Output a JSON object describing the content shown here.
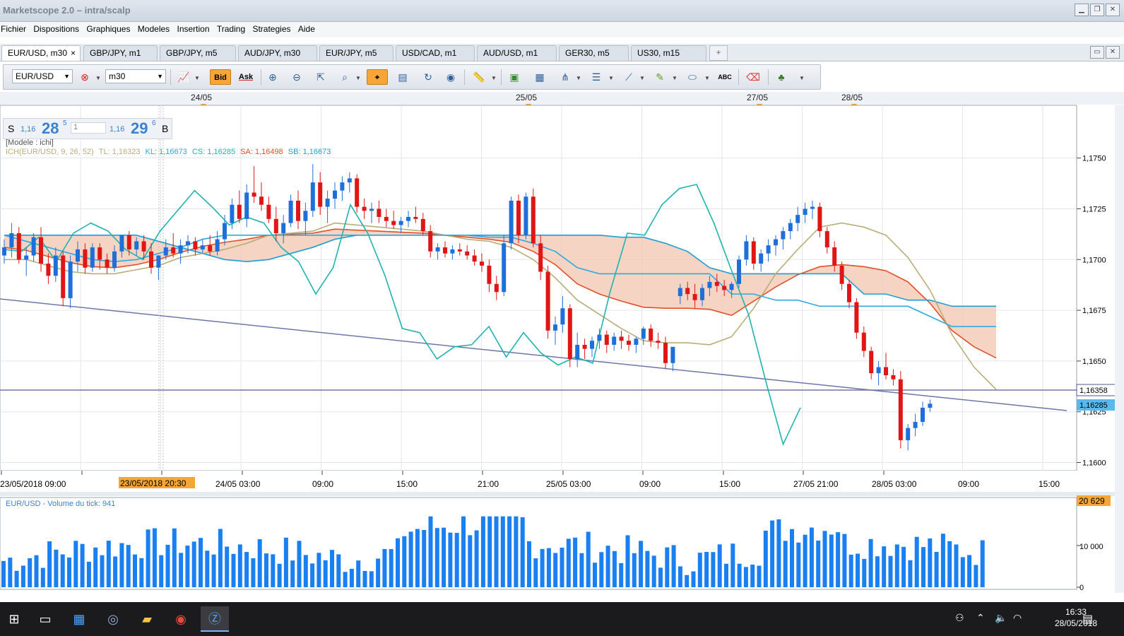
{
  "window": {
    "title": "Marketscope 2.0 – intra/scalp"
  },
  "menu": [
    "Fichier",
    "Dispositions",
    "Graphiques",
    "Modeles",
    "Insertion",
    "Trading",
    "Strategies",
    "Aide"
  ],
  "tabs": [
    {
      "label": "EUR/USD, m30",
      "active": true,
      "close": "×"
    },
    {
      "label": "GBP/JPY, m1"
    },
    {
      "label": "GBP/JPY, m5"
    },
    {
      "label": "AUD/JPY, m30"
    },
    {
      "label": "EUR/JPY, m5"
    },
    {
      "label": "USD/CAD, m1"
    },
    {
      "label": "AUD/USD, m1"
    },
    {
      "label": "GER30, m5"
    },
    {
      "label": "US30, m15"
    }
  ],
  "tab_add": "+",
  "toolbar": {
    "instrument": "EUR/USD",
    "timeframe": "m30",
    "bid_label": "Bid",
    "ask_label": "Ask",
    "abc_label": "ABC"
  },
  "price_panel": {
    "sell_letter": "S",
    "sell_prefix": "1,16",
    "sell_big": "28",
    "sell_sup": "5",
    "qty": "1",
    "buy_prefix": "1,16",
    "buy_big": "29",
    "buy_sup": "6",
    "buy_letter": "B"
  },
  "model_label": "[Modele : ichi]",
  "indicator_legend": [
    {
      "text": "ICH(EUR/USD, 9, 26, 52)",
      "color": "#b9ad7a"
    },
    {
      "text": "TL: 1,16323",
      "color": "#b9ad7a"
    },
    {
      "text": "KL: 1,16673",
      "color": "#2fa9e0"
    },
    {
      "text": "CS: 1,16285",
      "color": "#1db3b0"
    },
    {
      "text": "SA: 1,16498",
      "color": "#e0512a"
    },
    {
      "text": "SB: 1,16673",
      "color": "#1d9fd6"
    }
  ],
  "top_dates": [
    "24/05",
    "25/05",
    "27/05",
    "28/05"
  ],
  "price_axis": [
    "1,1750",
    "1,1725",
    "1,1700",
    "1,1675",
    "1,1650",
    "1,1625",
    "1,1600"
  ],
  "price_tags": {
    "current": "1,16358",
    "last": "1,16285"
  },
  "time_axis": [
    "23/05/2018 09:00",
    "24/05 03:00",
    "09:00",
    "15:00",
    "21:00",
    "25/05 03:00",
    "09:00",
    "15:00",
    "27/05 21:00",
    "28/05 03:00",
    "09:00",
    "15:00"
  ],
  "cursor_time": "23/05/2018 20:30",
  "volume": {
    "label": "EUR/USD - Volume du tick: 941",
    "axis": [
      "20 629",
      "10 000",
      "0"
    ]
  },
  "colors": {
    "up": "#1f6fd8",
    "down": "#e01515",
    "volume": "#1a7ff0",
    "cloud_bear": "#f3c9b5",
    "cloud_bull": "#cfe3f2",
    "accent": "#f5a637"
  },
  "chart_data": {
    "type": "candlestick",
    "instrument": "EUR/USD",
    "timeframe": "m30",
    "ylim": [
      1.1596,
      1.1776
    ],
    "x_range": [
      "23/05/2018 06:00",
      "28/05/2018 17:00"
    ],
    "candles": [
      [
        1.1702,
        1.171,
        1.1698,
        1.1706
      ],
      [
        1.1706,
        1.1718,
        1.1701,
        1.1713
      ],
      [
        1.1713,
        1.1716,
        1.1698,
        1.17
      ],
      [
        1.17,
        1.1706,
        1.1692,
        1.1702
      ],
      [
        1.1702,
        1.1713,
        1.1699,
        1.1711
      ],
      [
        1.1711,
        1.1716,
        1.1694,
        1.1698
      ],
      [
        1.1698,
        1.1703,
        1.1688,
        1.1692
      ],
      [
        1.1692,
        1.1706,
        1.1689,
        1.1702
      ],
      [
        1.1702,
        1.1704,
        1.1677,
        1.1681
      ],
      [
        1.1681,
        1.1702,
        1.1676,
        1.1699
      ],
      [
        1.1699,
        1.1709,
        1.1694,
        1.1705
      ],
      [
        1.1705,
        1.1708,
        1.1693,
        1.1696
      ],
      [
        1.1696,
        1.1708,
        1.1694,
        1.1706
      ],
      [
        1.1706,
        1.1708,
        1.1695,
        1.17
      ],
      [
        1.17,
        1.1703,
        1.1693,
        1.1696
      ],
      [
        1.1696,
        1.1707,
        1.1694,
        1.1704
      ],
      [
        1.1704,
        1.1712,
        1.1701,
        1.1712
      ],
      [
        1.1712,
        1.1714,
        1.1702,
        1.1705
      ],
      [
        1.1705,
        1.1711,
        1.1702,
        1.1709
      ],
      [
        1.1709,
        1.1712,
        1.17,
        1.1704
      ],
      [
        1.1704,
        1.1708,
        1.1693,
        1.1696
      ],
      [
        1.1696,
        1.17,
        1.169,
        1.1702
      ],
      [
        1.1702,
        1.171,
        1.17,
        1.1706
      ],
      [
        1.1706,
        1.1713,
        1.1701,
        1.1703
      ],
      [
        1.1703,
        1.171,
        1.1698,
        1.1707
      ],
      [
        1.1707,
        1.1712,
        1.1703,
        1.1709
      ],
      [
        1.1709,
        1.1711,
        1.1702,
        1.1705
      ],
      [
        1.1705,
        1.171,
        1.1703,
        1.1707
      ],
      [
        1.1707,
        1.1712,
        1.1702,
        1.1704
      ],
      [
        1.1704,
        1.1714,
        1.1702,
        1.171
      ],
      [
        1.171,
        1.1722,
        1.1707,
        1.1718
      ],
      [
        1.1718,
        1.173,
        1.1715,
        1.1727
      ],
      [
        1.1727,
        1.1734,
        1.1718,
        1.172
      ],
      [
        1.172,
        1.1737,
        1.1716,
        1.1733
      ],
      [
        1.1733,
        1.1746,
        1.1728,
        1.1731
      ],
      [
        1.1731,
        1.1738,
        1.1724,
        1.1727
      ],
      [
        1.1727,
        1.1731,
        1.1718,
        1.172
      ],
      [
        1.172,
        1.1726,
        1.1709,
        1.1713
      ],
      [
        1.1713,
        1.1722,
        1.1708,
        1.1718
      ],
      [
        1.1718,
        1.1732,
        1.1716,
        1.1729
      ],
      [
        1.1729,
        1.1734,
        1.1715,
        1.1719
      ],
      [
        1.1719,
        1.1728,
        1.1712,
        1.1724
      ],
      [
        1.1724,
        1.1747,
        1.1721,
        1.1738
      ],
      [
        1.1738,
        1.1743,
        1.1722,
        1.1726
      ],
      [
        1.1726,
        1.1734,
        1.1718,
        1.173
      ],
      [
        1.173,
        1.1738,
        1.1725,
        1.1734
      ],
      [
        1.1734,
        1.1741,
        1.1729,
        1.1738
      ],
      [
        1.1738,
        1.1743,
        1.1733,
        1.174
      ],
      [
        1.174,
        1.1742,
        1.1723,
        1.1726
      ],
      [
        1.1726,
        1.173,
        1.172,
        1.1724
      ],
      [
        1.1724,
        1.1728,
        1.1718,
        1.1725
      ],
      [
        1.1725,
        1.1729,
        1.1718,
        1.1721
      ],
      [
        1.1721,
        1.1725,
        1.1716,
        1.1719
      ],
      [
        1.1719,
        1.1724,
        1.1715,
        1.1717
      ],
      [
        1.1717,
        1.1721,
        1.1713,
        1.1719
      ],
      [
        1.1719,
        1.1724,
        1.1716,
        1.1721
      ],
      [
        1.1721,
        1.1726,
        1.1718,
        1.172
      ],
      [
        1.172,
        1.1723,
        1.1712,
        1.1714
      ],
      [
        1.1714,
        1.1717,
        1.1701,
        1.1704
      ],
      [
        1.1704,
        1.1708,
        1.17,
        1.1706
      ],
      [
        1.1706,
        1.1709,
        1.1701,
        1.1703
      ],
      [
        1.1703,
        1.1707,
        1.17,
        1.1705
      ],
      [
        1.1705,
        1.1708,
        1.1702,
        1.1704
      ],
      [
        1.1704,
        1.1707,
        1.17,
        1.1702
      ],
      [
        1.1702,
        1.1705,
        1.1697,
        1.1699
      ],
      [
        1.1699,
        1.1703,
        1.1694,
        1.1697
      ],
      [
        1.1697,
        1.17,
        1.1684,
        1.1688
      ],
      [
        1.1688,
        1.1692,
        1.168,
        1.1684
      ],
      [
        1.1684,
        1.1712,
        1.1682,
        1.1708
      ],
      [
        1.1708,
        1.1731,
        1.1705,
        1.1729
      ],
      [
        1.1729,
        1.1732,
        1.1708,
        1.1712
      ],
      [
        1.1712,
        1.1733,
        1.171,
        1.1731
      ],
      [
        1.1731,
        1.1735,
        1.1706,
        1.1708
      ],
      [
        1.1708,
        1.1712,
        1.169,
        1.1694
      ],
      [
        1.1694,
        1.1697,
        1.1661,
        1.1665
      ],
      [
        1.1665,
        1.1672,
        1.1658,
        1.1668
      ],
      [
        1.1668,
        1.1682,
        1.1664,
        1.1676
      ],
      [
        1.1676,
        1.1678,
        1.1647,
        1.1651
      ],
      [
        1.1651,
        1.1664,
        1.1647,
        1.1658
      ],
      [
        1.1658,
        1.1661,
        1.1651,
        1.1656
      ],
      [
        1.1656,
        1.1662,
        1.1652,
        1.166
      ],
      [
        1.166,
        1.1666,
        1.1656,
        1.1663
      ],
      [
        1.1663,
        1.1665,
        1.1654,
        1.1658
      ],
      [
        1.1658,
        1.1664,
        1.1655,
        1.1662
      ],
      [
        1.1662,
        1.1665,
        1.1656,
        1.166
      ],
      [
        1.166,
        1.1663,
        1.1655,
        1.1658
      ],
      [
        1.1658,
        1.1662,
        1.1654,
        1.1661
      ],
      [
        1.1661,
        1.1667,
        1.1658,
        1.1666
      ],
      [
        1.1666,
        1.1668,
        1.1657,
        1.166
      ],
      [
        1.166,
        1.1664,
        1.1656,
        1.1659
      ],
      [
        1.1659,
        1.1662,
        1.1646,
        1.1649
      ],
      [
        1.1649,
        1.1652,
        1.1645,
        1.1657
      ],
      [
        1.1682,
        1.1688,
        1.1678,
        1.1686
      ],
      [
        1.1686,
        1.1689,
        1.168,
        1.1683
      ],
      [
        1.1683,
        1.1688,
        1.1676,
        1.168
      ],
      [
        1.168,
        1.1688,
        1.1677,
        1.1686
      ],
      [
        1.1686,
        1.1692,
        1.1682,
        1.1689
      ],
      [
        1.1689,
        1.1693,
        1.1684,
        1.1687
      ],
      [
        1.1687,
        1.169,
        1.1682,
        1.1685
      ],
      [
        1.1685,
        1.1689,
        1.1681,
        1.1688
      ],
      [
        1.1688,
        1.1702,
        1.1686,
        1.17
      ],
      [
        1.17,
        1.1712,
        1.1697,
        1.1709
      ],
      [
        1.1709,
        1.1711,
        1.1695,
        1.1698
      ],
      [
        1.1698,
        1.1705,
        1.1694,
        1.1703
      ],
      [
        1.1703,
        1.171,
        1.1699,
        1.1707
      ],
      [
        1.1707,
        1.1712,
        1.1702,
        1.171
      ],
      [
        1.171,
        1.1716,
        1.1705,
        1.1714
      ],
      [
        1.1714,
        1.172,
        1.171,
        1.1718
      ],
      [
        1.1718,
        1.1726,
        1.1714,
        1.1722
      ],
      [
        1.1722,
        1.1728,
        1.1718,
        1.1725
      ],
      [
        1.1725,
        1.1729,
        1.172,
        1.1726
      ],
      [
        1.1726,
        1.1728,
        1.1711,
        1.1714
      ],
      [
        1.1714,
        1.1716,
        1.1703,
        1.1706
      ],
      [
        1.1706,
        1.1709,
        1.1694,
        1.1697
      ],
      [
        1.1697,
        1.1699,
        1.1685,
        1.1688
      ],
      [
        1.1688,
        1.169,
        1.1676,
        1.1679
      ],
      [
        1.1679,
        1.1681,
        1.1661,
        1.1664
      ],
      [
        1.1664,
        1.1667,
        1.1652,
        1.1655
      ],
      [
        1.1655,
        1.1657,
        1.1641,
        1.1644
      ],
      [
        1.1644,
        1.165,
        1.1638,
        1.1647
      ],
      [
        1.1647,
        1.1654,
        1.1641,
        1.1643
      ],
      [
        1.1643,
        1.1646,
        1.1638,
        1.1641
      ],
      [
        1.1641,
        1.1645,
        1.1607,
        1.1611
      ],
      [
        1.1611,
        1.1619,
        1.1606,
        1.1617
      ],
      [
        1.1617,
        1.1624,
        1.1613,
        1.162
      ],
      [
        1.162,
        1.163,
        1.1618,
        1.1627
      ],
      [
        1.1627,
        1.1631,
        1.1625,
        1.1629
      ]
    ],
    "tenkan": [
      1.17,
      1.17,
      1.1697,
      1.1694,
      1.1693,
      1.1693,
      1.1695,
      1.1697,
      1.1701,
      1.1703,
      1.1705,
      1.1708,
      1.1712,
      1.1713,
      1.1714,
      1.1718,
      1.1717,
      1.1716,
      1.1715,
      1.1714,
      1.1712,
      1.171,
      1.1709,
      1.1706,
      1.17,
      1.1691,
      1.168,
      1.1673,
      1.1666,
      1.166,
      1.1659,
      1.1659,
      1.1658,
      1.1662,
      1.1676,
      1.1693,
      1.1705,
      1.1716,
      1.1718,
      1.1716,
      1.1712,
      1.1701,
      1.1685,
      1.1663,
      1.1647,
      1.1636
    ],
    "kijun": [
      1.1712,
      1.1709,
      1.1706,
      1.1703,
      1.17,
      1.1699,
      1.17,
      1.1703,
      1.1706,
      1.171,
      1.1712,
      1.1712,
      1.1712,
      1.1712,
      1.1712,
      1.1712,
      1.1712,
      1.1712,
      1.1712,
      1.1712,
      1.1712,
      1.1712,
      1.1711,
      1.1711,
      1.1708,
      1.1704,
      1.1696,
      1.1693,
      1.1693,
      1.1693,
      1.1693,
      1.1693,
      1.1693,
      1.1683,
      1.1683,
      1.168,
      1.168,
      1.1677,
      1.1677,
      1.1677,
      1.1677,
      1.1677,
      1.1672,
      1.1667,
      1.1667,
      1.1667
    ],
    "chikou": [
      1.1705,
      1.1704,
      1.1711,
      1.1699,
      1.1713,
      1.1718,
      1.1714,
      1.1705,
      1.17,
      1.1714,
      1.1724,
      1.1734,
      1.1726,
      1.1717,
      1.1721,
      1.1718,
      1.1706,
      1.1699,
      1.1683,
      1.1696,
      1.1727,
      1.1713,
      1.1692,
      1.1666,
      1.1664,
      1.1651,
      1.1657,
      1.1658,
      1.1667,
      1.1652,
      1.1664,
      1.1654,
      1.1648,
      1.1652,
      1.1649,
      1.1684,
      1.1713,
      1.1712,
      1.1727,
      1.1735,
      1.1737,
      1.1718,
      1.1695,
      1.1673,
      1.164,
      1.1609,
      1.1627
    ]
  }
}
